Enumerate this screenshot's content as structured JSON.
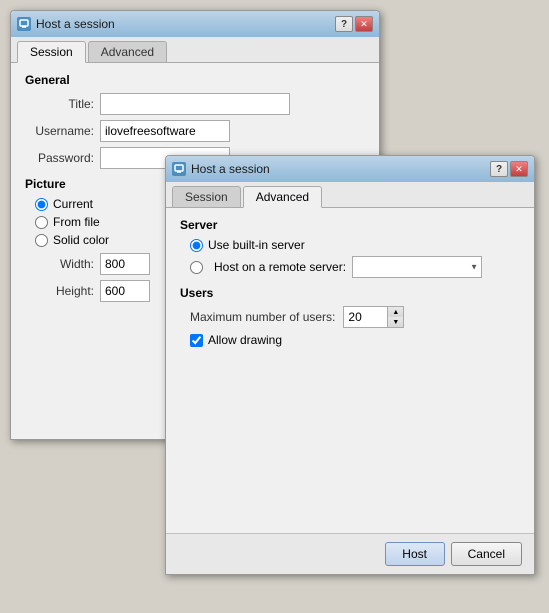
{
  "window1": {
    "title": "Host a session",
    "tabs": [
      {
        "id": "session",
        "label": "Session",
        "active": false
      },
      {
        "id": "advanced",
        "label": "Advanced",
        "active": false
      }
    ],
    "general": {
      "section_label": "General",
      "title_label": "Title:",
      "title_value": "",
      "username_label": "Username:",
      "username_value": "ilovefreesoftware",
      "password_label": "Password:",
      "password_value": ""
    },
    "picture": {
      "section_label": "Picture",
      "options": [
        "Current",
        "From file",
        "Solid color"
      ],
      "selected": "Current",
      "width_label": "Width:",
      "width_value": "800",
      "height_label": "Height:",
      "height_value": "600"
    },
    "buttons": {
      "help": "?",
      "close": "✕"
    }
  },
  "window2": {
    "title": "Host a session",
    "tabs": [
      {
        "id": "session",
        "label": "Session",
        "active": false
      },
      {
        "id": "advanced",
        "label": "Advanced",
        "active": true
      }
    ],
    "server": {
      "section_label": "Server",
      "options": [
        {
          "id": "builtin",
          "label": "Use built-in server",
          "selected": true
        },
        {
          "id": "remote",
          "label": "Host on a remote server:",
          "selected": false
        }
      ],
      "dropdown_value": "",
      "dropdown_placeholder": ""
    },
    "users": {
      "section_label": "Users",
      "max_users_label": "Maximum number of users:",
      "max_users_value": "20",
      "allow_drawing_label": "Allow drawing",
      "allow_drawing_checked": true
    },
    "buttons": {
      "help": "?",
      "close": "✕",
      "host": "Host",
      "cancel": "Cancel"
    }
  }
}
